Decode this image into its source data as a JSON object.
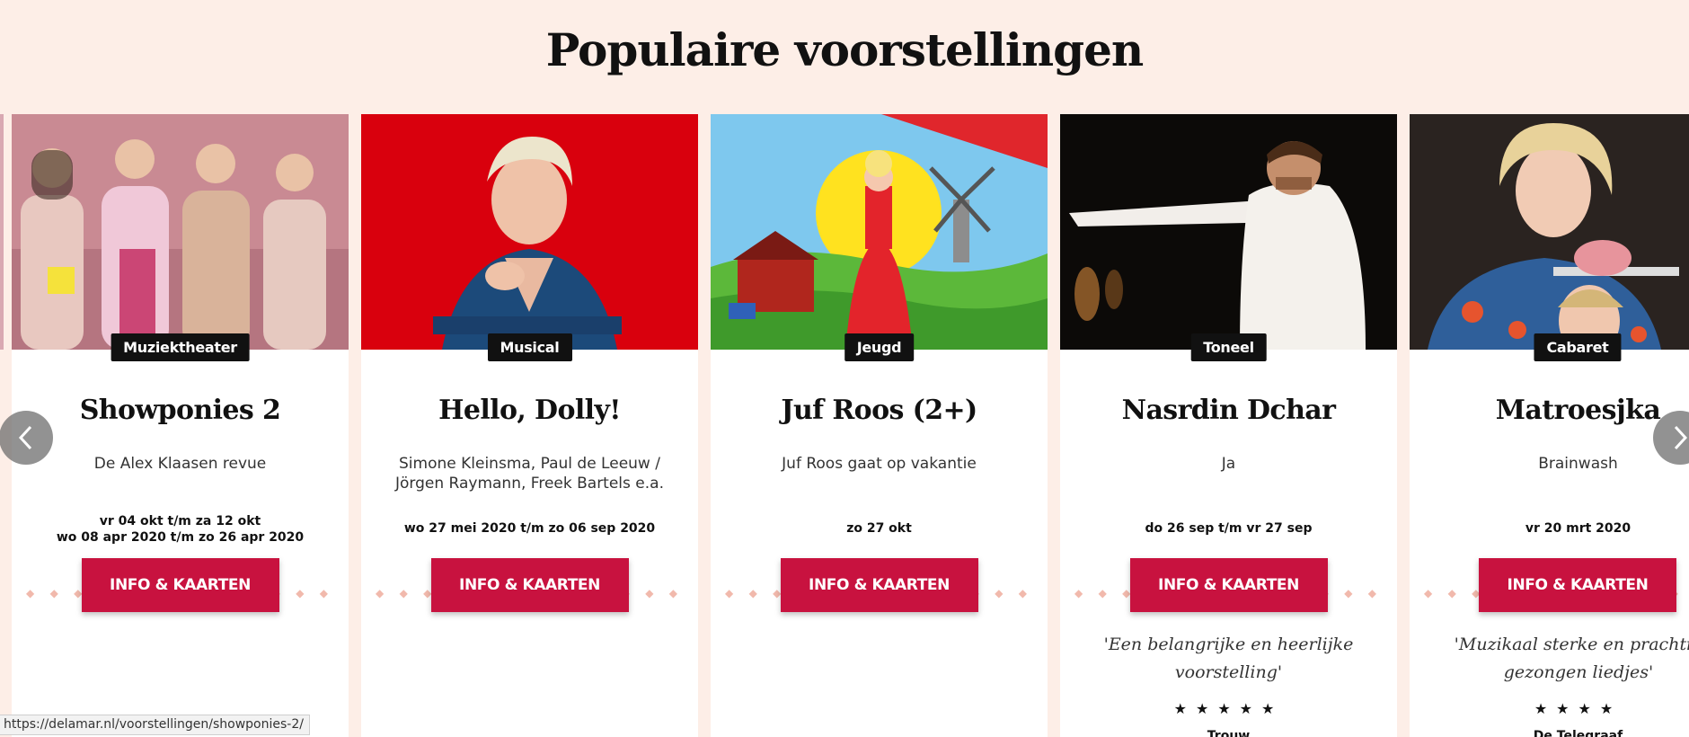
{
  "section": {
    "title": "Populaire voorstellingen"
  },
  "cards": [
    {
      "category": "Muziektheater",
      "title": "Showponies 2",
      "subtitle": "De Alex Klaasen revue",
      "dates": [
        "vr 04 okt t/m za 12 okt",
        "wo 08 apr 2020 t/m zo 26 apr 2020"
      ],
      "cta": "INFO & KAARTEN",
      "image": "showponies-cast-photo"
    },
    {
      "category": "Musical",
      "title": "Hello, Dolly!",
      "subtitle": "Simone Kleinsma, Paul de Leeuw / Jörgen Raymann, Freek Bartels e.a.",
      "dates": [
        "wo 27 mei 2020 t/m zo 06 sep 2020"
      ],
      "cta": "INFO & KAARTEN",
      "image": "hello-dolly-portrait"
    },
    {
      "category": "Jeugd",
      "title": "Juf Roos (2+)",
      "subtitle": "Juf Roos gaat op vakantie",
      "dates": [
        "zo 27 okt"
      ],
      "cta": "INFO & KAARTEN",
      "image": "juf-roos-illustration"
    },
    {
      "category": "Toneel",
      "title": "Nasrdin Dchar",
      "subtitle": "Ja",
      "dates": [
        "do 26 sep t/m vr 27 sep"
      ],
      "cta": "INFO & KAARTEN",
      "quote": "'Een belangrijke en heerlijke voorstelling'",
      "stars": "★★★★★",
      "source": "Trouw",
      "image": "nasrdin-dchar-stage-photo"
    },
    {
      "category": "Cabaret",
      "title": "Matroesjka",
      "subtitle": "Brainwash",
      "dates": [
        "vr 20 mrt 2020"
      ],
      "cta": "INFO & KAARTEN",
      "quote": "'Muzikaal sterke en prachtig gezongen liedjes'",
      "stars": "★★★★",
      "source": "De Telegraaf",
      "image": "matroesjka-portrait"
    }
  ],
  "nav": {
    "prev_icon": "chevron-left-icon",
    "next_icon": "chevron-right-icon"
  },
  "status_bar": {
    "url": "https://delamar.nl/voorstellingen/showponies-2/"
  },
  "colors": {
    "background": "#fdeee7",
    "accent": "#c8123f",
    "badge": "#111111"
  }
}
